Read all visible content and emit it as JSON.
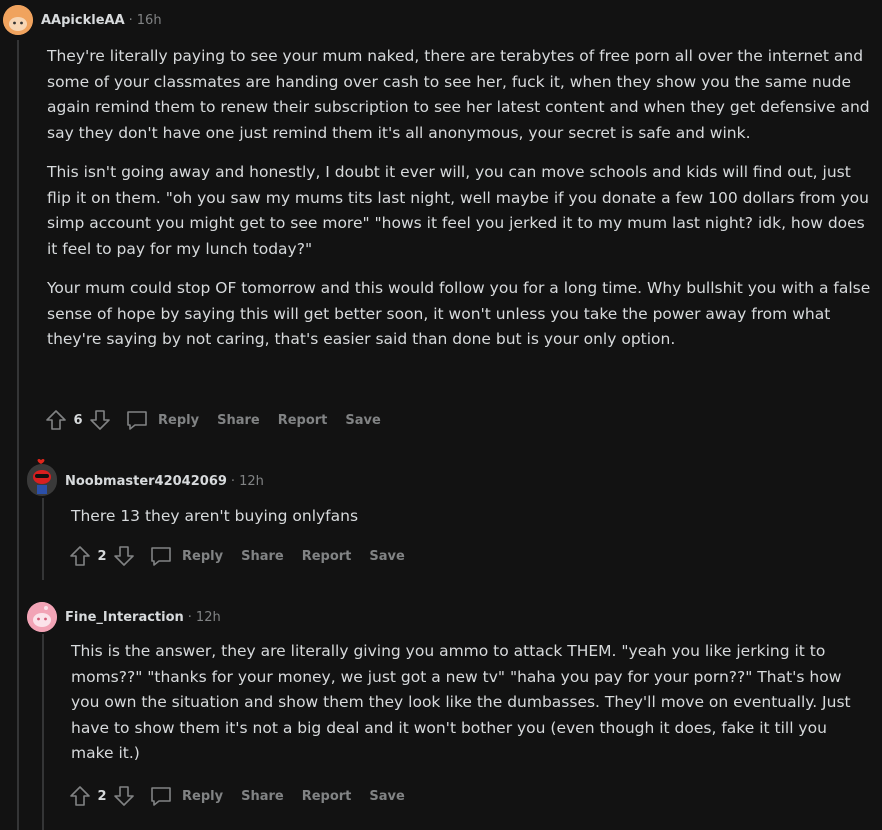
{
  "comments": [
    {
      "username": "AApickleAA",
      "time": "16h",
      "paragraphs": [
        "They're literally paying to see your mum naked, there are terabytes of free porn all over the internet and some of your classmates are handing over cash to see her, fuck it, when they show you the same nude again remind them to renew their subscription to see her latest content and when they get defensive and say they don't have one just remind them it's all anonymous, your secret is safe and wink.",
        "This isn't going away and honestly, I doubt it ever will, you can move schools and kids will find out, just flip it on them. \"oh you saw my mums tits last night, well maybe if you donate a few 100 dollars from you simp account you might get to see more\" \"hows it feel you jerked it to my mum last night? idk, how does it feel to pay for my lunch today?\"",
        "Your mum could stop OF tomorrow and this would follow you for a long time. Why bullshit you with a false sense of hope by saying this will get better soon, it won't unless you take the power away from what they're saying by not caring, that's easier said than done but is your only option."
      ],
      "votes": "6"
    },
    {
      "username": "Noobmaster42042069",
      "time": "12h",
      "paragraphs": [
        "There 13 they aren't buying onlyfans"
      ],
      "votes": "2"
    },
    {
      "username": "Fine_Interaction",
      "time": "12h",
      "paragraphs": [
        "This is the answer, they are literally giving you ammo to attack THEM. \"yeah you like jerking it to moms??\" \"thanks for your money, we just got a new tv\" \"haha you pay for your porn??\" That's how you own the situation and show them they look like the dumbasses. They'll move on eventually. Just have to show them it's not a big deal and it won't bother you (even though it does, fake it till you make it.)"
      ],
      "votes": "2"
    }
  ],
  "labels": {
    "separator": "·",
    "reply": "Reply",
    "share": "Share",
    "report": "Report",
    "save": "Save"
  },
  "colors": {
    "background": "#121212",
    "text": "#d7dadc",
    "muted": "#818384",
    "thread_line": "#343536"
  }
}
